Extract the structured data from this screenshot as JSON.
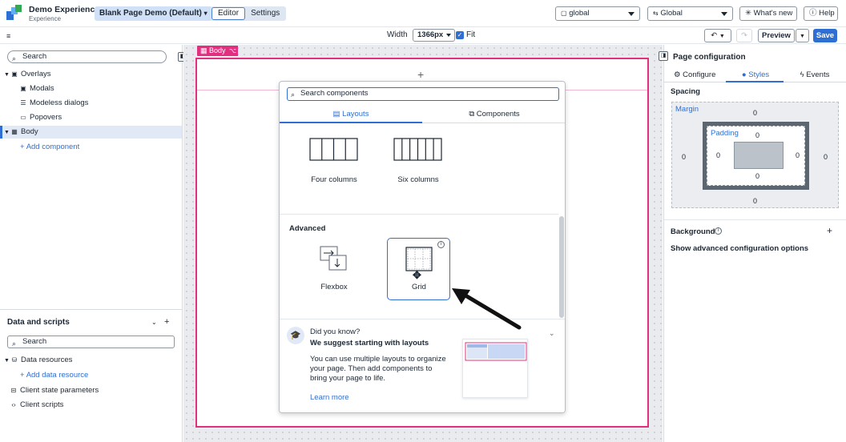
{
  "header": {
    "app_title": "Demo Experience",
    "app_subtitle": "Experience",
    "page_select": "Blank Page Demo (Default)",
    "mode_tabs": [
      "Editor",
      "Settings"
    ],
    "theme_select": "global",
    "scope_select": "Global",
    "whats_new": "What's new",
    "help": "Help"
  },
  "toolbar": {
    "width_label": "Width",
    "width_value": "1366px",
    "fit_label": "Fit",
    "preview": "Preview",
    "save": "Save"
  },
  "left_panel": {
    "search_placeholder": "Search",
    "tree": [
      {
        "label": "Overlays",
        "icon": "overlay-icon"
      },
      {
        "label": "Modals",
        "icon": "modal-icon"
      },
      {
        "label": "Modeless dialogs",
        "icon": "dialog-icon"
      },
      {
        "label": "Popovers",
        "icon": "popover-icon"
      },
      {
        "label": "Body",
        "icon": "body-icon"
      }
    ],
    "add_component": "Add component",
    "data_title": "Data and scripts",
    "data_search_placeholder": "Search",
    "data_tree": {
      "resources": "Data resources",
      "add_resource": "Add data resource",
      "client_state": "Client state parameters",
      "client_scripts": "Client scripts"
    }
  },
  "canvas": {
    "body_tag": "Body"
  },
  "picker": {
    "search_placeholder": "Search components",
    "tabs": [
      "Layouts",
      "Components"
    ],
    "layouts": [
      "Four columns",
      "Six columns"
    ],
    "advanced_title": "Advanced",
    "advanced": [
      "Flexbox",
      "Grid"
    ],
    "tip": {
      "kicker": "Did you know?",
      "title": "We suggest starting with layouts",
      "body_lines": [
        "You can use multiple layouts to organize",
        "your page. Then add components to",
        "bring your page to life."
      ],
      "link": "Learn more"
    }
  },
  "right_panel": {
    "title": "Page configuration",
    "tabs": [
      "Configure",
      "Styles",
      "Events"
    ],
    "spacing_title": "Spacing",
    "margin_label": "Margin",
    "padding_label": "Padding",
    "margin": {
      "top": "0",
      "right": "0",
      "bottom": "0",
      "left": "0"
    },
    "padding": {
      "top": "0",
      "right": "0",
      "bottom": "0",
      "left": "0"
    },
    "background_title": "Background",
    "advanced_link": "Show advanced configuration options"
  },
  "colors": {
    "accent": "#2f6fd4",
    "selection": "#e0307f",
    "page_select_bg": "#cfe0f7"
  }
}
